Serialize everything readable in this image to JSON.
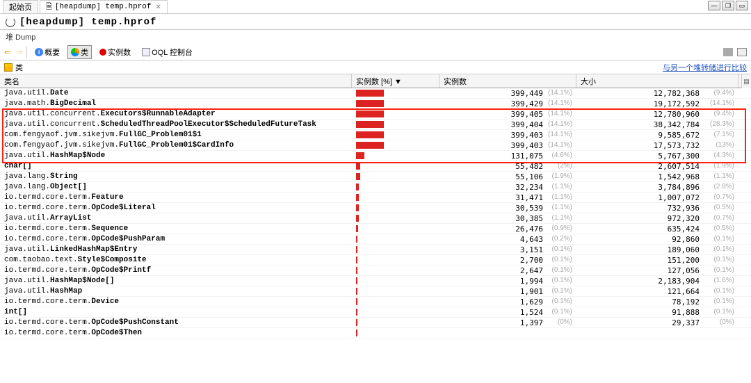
{
  "tabs": {
    "start": "起始页",
    "heapdump": "[heapdump] temp.hprof",
    "heapdump_icon": "📋"
  },
  "title": "[heapdump] temp.hprof",
  "sublabel": "堆 Dump",
  "toolbar": {
    "overview": "概要",
    "classes": "类",
    "instances": "实例数",
    "oql": "OQL 控制台"
  },
  "class_header": "类",
  "compare_link": "与另一个堆转储进行比较",
  "columns": {
    "name": "类名",
    "pct": "实例数  [%] ▼",
    "instances": "实例数",
    "size": "大小"
  },
  "rows": [
    {
      "pkg": "java.util.",
      "cls": "Date",
      "bar": 40,
      "inst": "399,449",
      "inst_pct": "(14.1%)",
      "size": "12,782,368",
      "size_pct": "(9.4%)"
    },
    {
      "pkg": "java.math.",
      "cls": "BigDecimal",
      "bar": 40,
      "inst": "399,429",
      "inst_pct": "(14.1%)",
      "size": "19,172,592",
      "size_pct": "(14.1%)"
    },
    {
      "pkg": "java.util.concurrent.",
      "cls": "Executors$RunnableAdapter",
      "bar": 40,
      "inst": "399,405",
      "inst_pct": "(14.1%)",
      "size": "12,780,960",
      "size_pct": "(9.4%)"
    },
    {
      "pkg": "java.util.concurrent.",
      "cls": "ScheduledThreadPoolExecutor$ScheduledFutureTask",
      "bar": 40,
      "inst": "399,404",
      "inst_pct": "(14.1%)",
      "size": "38,342,784",
      "size_pct": "(28.3%)"
    },
    {
      "pkg": "com.fengyaof.jvm.sikejvm.",
      "cls": "FullGC_Problem01$1",
      "bar": 40,
      "inst": "399,403",
      "inst_pct": "(14.1%)",
      "size": "9,585,672",
      "size_pct": "(7.1%)"
    },
    {
      "pkg": "com.fengyaof.jvm.sikejvm.",
      "cls": "FullGC_Problem01$CardInfo",
      "bar": 40,
      "inst": "399,403",
      "inst_pct": "(14.1%)",
      "size": "17,573,732",
      "size_pct": "(13%)"
    },
    {
      "pkg": "java.util.",
      "cls": "HashMap$Node",
      "bar": 12,
      "inst": "131,075",
      "inst_pct": "(4.6%)",
      "size": "5,767,300",
      "size_pct": "(4.3%)"
    },
    {
      "pkg": "",
      "cls": "char[]",
      "bar": 6,
      "inst": "55,482",
      "inst_pct": "(2%)",
      "size": "2,607,514",
      "size_pct": "(1.9%)"
    },
    {
      "pkg": "java.lang.",
      "cls": "String",
      "bar": 6,
      "inst": "55,106",
      "inst_pct": "(1.9%)",
      "size": "1,542,968",
      "size_pct": "(1.1%)"
    },
    {
      "pkg": "java.lang.",
      "cls": "Object[]",
      "bar": 4,
      "inst": "32,234",
      "inst_pct": "(1.1%)",
      "size": "3,784,896",
      "size_pct": "(2.8%)"
    },
    {
      "pkg": "io.termd.core.term.",
      "cls": "Feature",
      "bar": 4,
      "inst": "31,471",
      "inst_pct": "(1.1%)",
      "size": "1,007,072",
      "size_pct": "(0.7%)"
    },
    {
      "pkg": "io.termd.core.term.",
      "cls": "OpCode$Literal",
      "bar": 4,
      "inst": "30,539",
      "inst_pct": "(1.1%)",
      "size": "732,936",
      "size_pct": "(0.5%)"
    },
    {
      "pkg": "java.util.",
      "cls": "ArrayList",
      "bar": 4,
      "inst": "30,385",
      "inst_pct": "(1.1%)",
      "size": "972,320",
      "size_pct": "(0.7%)"
    },
    {
      "pkg": "io.termd.core.term.",
      "cls": "Sequence",
      "bar": 3,
      "inst": "26,476",
      "inst_pct": "(0.9%)",
      "size": "635,424",
      "size_pct": "(0.5%)"
    },
    {
      "pkg": "io.termd.core.term.",
      "cls": "OpCode$PushParam",
      "bar": 2,
      "inst": "4,643",
      "inst_pct": "(0.2%)",
      "size": "92,860",
      "size_pct": "(0.1%)"
    },
    {
      "pkg": "java.util.",
      "cls": "LinkedHashMap$Entry",
      "bar": 2,
      "inst": "3,151",
      "inst_pct": "(0.1%)",
      "size": "189,060",
      "size_pct": "(0.1%)"
    },
    {
      "pkg": "com.taobao.text.",
      "cls": "Style$Composite",
      "bar": 2,
      "inst": "2,700",
      "inst_pct": "(0.1%)",
      "size": "151,200",
      "size_pct": "(0.1%)"
    },
    {
      "pkg": "io.termd.core.term.",
      "cls": "OpCode$Printf",
      "bar": 2,
      "inst": "2,647",
      "inst_pct": "(0.1%)",
      "size": "127,056",
      "size_pct": "(0.1%)"
    },
    {
      "pkg": "java.util.",
      "cls": "HashMap$Node[]",
      "bar": 2,
      "inst": "1,994",
      "inst_pct": "(0.1%)",
      "size": "2,183,904",
      "size_pct": "(1.6%)"
    },
    {
      "pkg": "java.util.",
      "cls": "HashMap",
      "bar": 2,
      "inst": "1,901",
      "inst_pct": "(0.1%)",
      "size": "121,664",
      "size_pct": "(0.1%)"
    },
    {
      "pkg": "io.termd.core.term.",
      "cls": "Device",
      "bar": 2,
      "inst": "1,629",
      "inst_pct": "(0.1%)",
      "size": "78,192",
      "size_pct": "(0.1%)"
    },
    {
      "pkg": "",
      "cls": "int[]",
      "bar": 2,
      "inst": "1,524",
      "inst_pct": "(0.1%)",
      "size": "91,888",
      "size_pct": "(0.1%)"
    },
    {
      "pkg": "io.termd.core.term.",
      "cls": "OpCode$PushConstant",
      "bar": 2,
      "inst": "1,397",
      "inst_pct": "(0%)",
      "size": "29,337",
      "size_pct": "(0%)"
    },
    {
      "pkg": "io.termd.core.term.",
      "cls": "OpCode$Then",
      "bar": 2,
      "inst": "",
      "inst_pct": "",
      "size": "",
      "size_pct": ""
    }
  ]
}
